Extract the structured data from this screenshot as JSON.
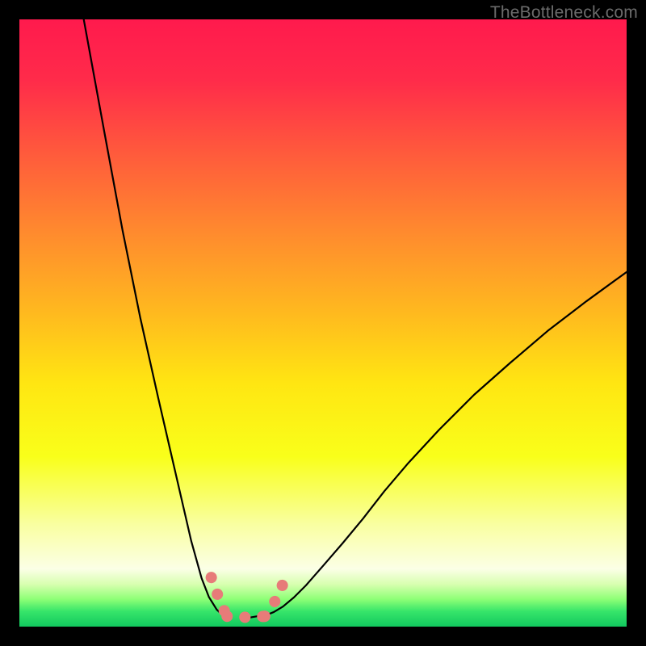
{
  "watermark": "TheBottleneck.com",
  "chart_data": {
    "type": "line",
    "title": "",
    "xlabel": "",
    "ylabel": "",
    "xlim": [
      0,
      100
    ],
    "ylim": [
      0,
      100
    ],
    "grid": false,
    "note": "Two curves over a vertical rainbow gradient (red top → green bottom). Left curve descends steeply from the top-left toward a minimum near x≈35; right curve ascends from that minimum toward the upper-right, ending near y≈60 at x=100. Values are read off approximate pixel positions (0–100 normalized).",
    "series": [
      {
        "name": "left-curve",
        "x": [
          10.6,
          14.0,
          17.0,
          19.9,
          22.9,
          25.9,
          28.3,
          30.0,
          31.2,
          32.5,
          33.8,
          34.0
        ],
        "y": [
          100.0,
          81.4,
          65.2,
          50.9,
          37.5,
          24.5,
          14.1,
          8.0,
          4.9,
          2.8,
          1.6,
          1.5
        ]
      },
      {
        "name": "right-curve",
        "x": [
          38.0,
          40.9,
          41.9,
          43.4,
          45.2,
          47.2,
          50.0,
          53.2,
          56.6,
          60.1,
          64.1,
          69.1,
          74.9,
          80.9,
          87.0,
          93.4,
          100.0
        ],
        "y": [
          1.5,
          2.0,
          2.4,
          3.3,
          4.8,
          6.8,
          10.0,
          13.7,
          17.8,
          22.3,
          27.0,
          32.4,
          38.2,
          43.5,
          48.7,
          53.6,
          58.4
        ]
      },
      {
        "name": "marker-left-descender",
        "style": "thick-pink",
        "x": [
          31.6,
          33.2,
          34.2
        ],
        "y": [
          8.1,
          3.7,
          1.7
        ]
      },
      {
        "name": "marker-bottom",
        "style": "thick-pink",
        "x": [
          34.2,
          38.0,
          40.4
        ],
        "y": [
          1.7,
          1.5,
          1.7
        ]
      },
      {
        "name": "marker-right-ascender",
        "style": "thick-pink",
        "x": [
          40.4,
          42.0,
          43.2,
          44.0
        ],
        "y": [
          1.7,
          4.0,
          6.6,
          8.1
        ]
      }
    ],
    "background_gradient": {
      "direction": "vertical",
      "stops": [
        {
          "pos": 0.0,
          "color": "#ff1a4d"
        },
        {
          "pos": 0.1,
          "color": "#ff2b4a"
        },
        {
          "pos": 0.22,
          "color": "#ff5a3c"
        },
        {
          "pos": 0.35,
          "color": "#ff8a2e"
        },
        {
          "pos": 0.48,
          "color": "#ffb81f"
        },
        {
          "pos": 0.6,
          "color": "#ffe612"
        },
        {
          "pos": 0.72,
          "color": "#f9ff1a"
        },
        {
          "pos": 0.83,
          "color": "#f9ff9f"
        },
        {
          "pos": 0.905,
          "color": "#fbffe6"
        },
        {
          "pos": 0.93,
          "color": "#d8ffb0"
        },
        {
          "pos": 0.955,
          "color": "#8dff76"
        },
        {
          "pos": 0.975,
          "color": "#36e56a"
        },
        {
          "pos": 1.0,
          "color": "#11c85e"
        }
      ]
    },
    "marker_color": "#e77b79",
    "curve_color": "#000000"
  }
}
